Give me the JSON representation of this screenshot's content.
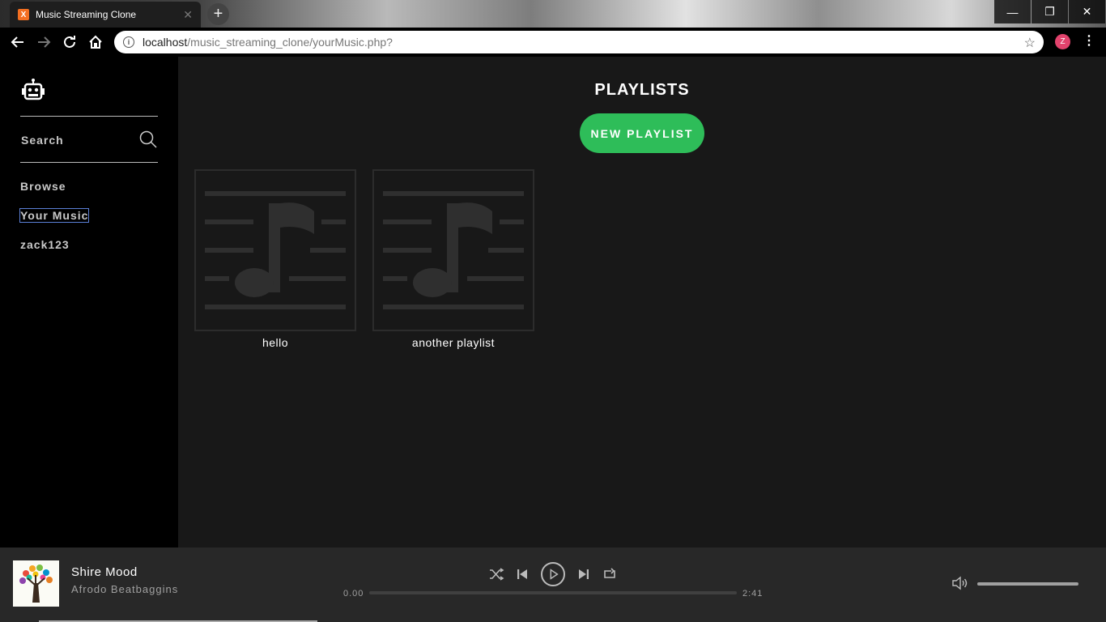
{
  "browser": {
    "tab_title": "Music Streaming Clone",
    "favicon_letter": "X",
    "url_host": "localhost",
    "url_path": "/music_streaming_clone/yourMusic.php?",
    "profile_initial": "Z"
  },
  "sidebar": {
    "search_label": "Search",
    "nav": [
      {
        "label": "Browse"
      },
      {
        "label": "Your Music",
        "active": true
      },
      {
        "label": "zack123"
      }
    ]
  },
  "main": {
    "title": "PLAYLISTS",
    "new_playlist_label": "NEW PLAYLIST",
    "playlists": [
      {
        "name": "hello"
      },
      {
        "name": "another playlist"
      }
    ]
  },
  "player": {
    "track": "Shire Mood",
    "artist": "Afrodo Beatbaggins",
    "current_time": "0.00",
    "duration": "2:41",
    "progress": 0,
    "volume": 1.0
  },
  "icons": {
    "logo": "robot-icon",
    "search": "search-icon",
    "shuffle": "shuffle-icon",
    "previous": "previous-icon",
    "play": "play-icon",
    "next": "next-icon",
    "repeat": "repeat-icon",
    "volume": "volume-icon"
  },
  "colors": {
    "accent": "#2ebd59",
    "sidebar_bg": "#000000",
    "main_bg": "#181818",
    "player_bg": "#282828"
  }
}
